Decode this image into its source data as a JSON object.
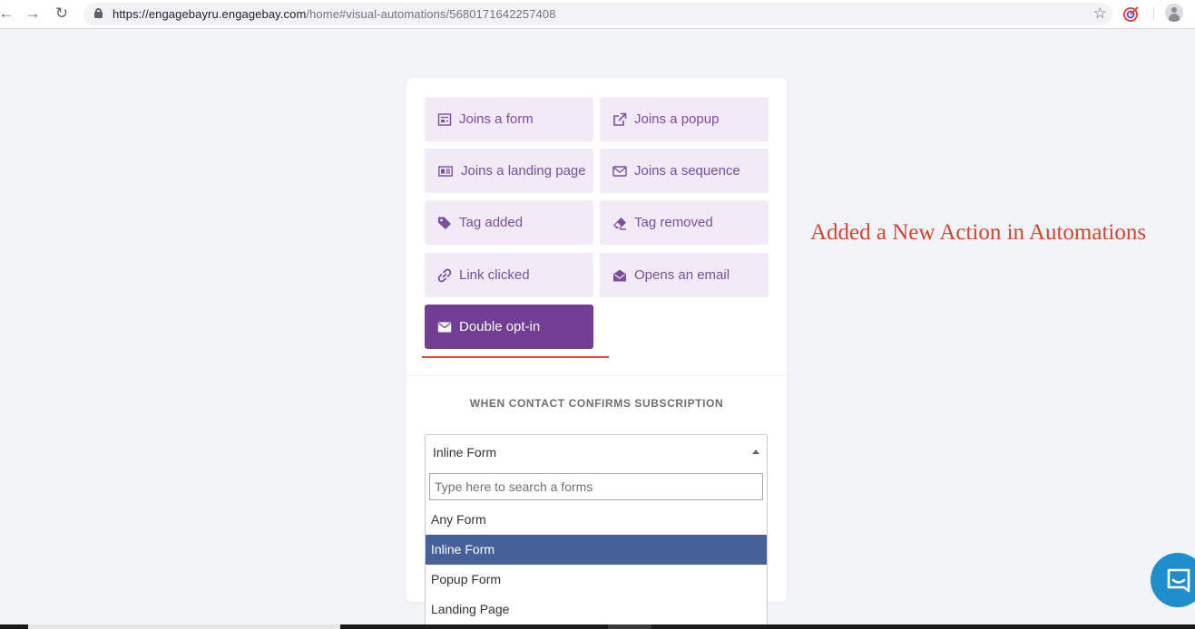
{
  "browser": {
    "url_host": "https://engagebayru.engagebay.com",
    "url_path": "/home#visual-automations/5680171642257408"
  },
  "triggers": [
    {
      "label": "Joins a form",
      "icon": "form-icon",
      "active": false
    },
    {
      "label": "Joins a popup",
      "icon": "external-link-icon",
      "active": false
    },
    {
      "label": "Joins a landing page",
      "icon": "landing-page-icon",
      "active": false
    },
    {
      "label": "Joins a sequence",
      "icon": "envelope-outline-icon",
      "active": false
    },
    {
      "label": "Tag added",
      "icon": "tag-icon",
      "active": false
    },
    {
      "label": "Tag removed",
      "icon": "eraser-icon",
      "active": false
    },
    {
      "label": "Link clicked",
      "icon": "link-icon",
      "active": false
    },
    {
      "label": "Opens an email",
      "icon": "envelope-open-icon",
      "active": false
    },
    {
      "label": "Double opt-in",
      "icon": "envelope-icon",
      "active": true
    }
  ],
  "section": {
    "label": "WHEN CONTACT CONFIRMS SUBSCRIPTION"
  },
  "select": {
    "value": "Inline Form",
    "search_placeholder": "Type here to search a forms",
    "options": [
      {
        "label": "Any Form",
        "selected": false
      },
      {
        "label": "Inline Form",
        "selected": true
      },
      {
        "label": "Popup Form",
        "selected": false
      },
      {
        "label": "Landing Page",
        "selected": false
      }
    ]
  },
  "annotation": {
    "text": "Added a New Action in Automations"
  },
  "colors": {
    "tile_bg": "#f3eaf8",
    "tile_text": "#7b4ea0",
    "active_tile_bg": "#723e93",
    "selected_option_bg": "#46609a",
    "annotation": "#d44234",
    "chat_launcher": "#1f8ecd"
  }
}
